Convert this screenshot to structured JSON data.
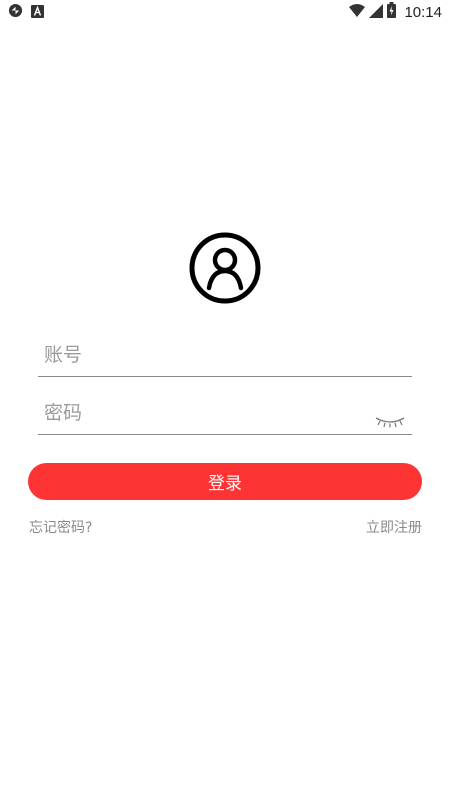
{
  "status_bar": {
    "time": "10:14",
    "left_icons": [
      "sync-icon",
      "app-a-icon"
    ],
    "right_icons": [
      "wifi-icon",
      "signal-icon",
      "battery-icon"
    ]
  },
  "login": {
    "avatar_icon": "user-circle-icon",
    "account_placeholder": "账号",
    "account_value": "",
    "password_placeholder": "密码",
    "password_value": "",
    "password_toggle_icon": "eye-closed-icon",
    "login_button_label": "登录",
    "forgot_password_label": "忘记密码?",
    "register_label": "立即注册"
  },
  "colors": {
    "accent": "#fe3434",
    "link_text": "#8a8a8a",
    "placeholder": "#9a9a9a",
    "background": "#ffffff"
  }
}
